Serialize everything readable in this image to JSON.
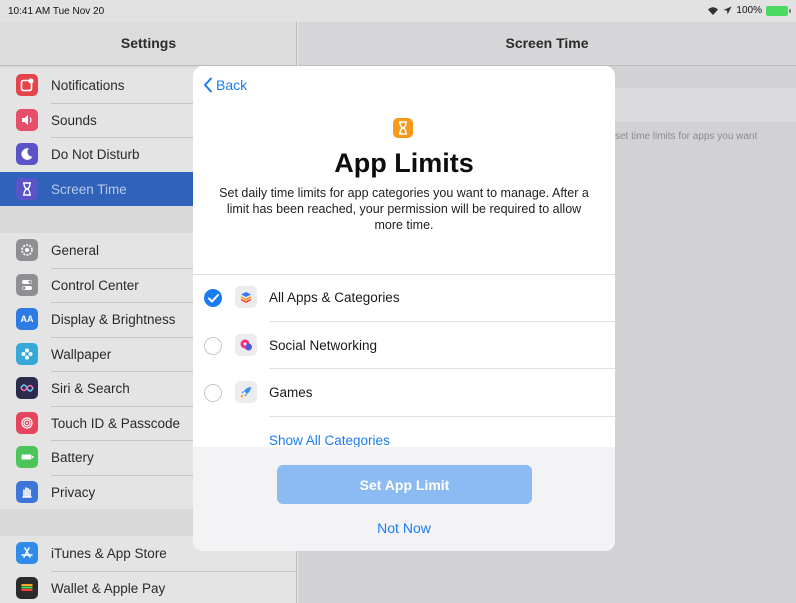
{
  "status_bar": {
    "time": "10:41 AM  Tue Nov 20",
    "battery": "100%"
  },
  "sidebar": {
    "title": "Settings",
    "groups": [
      [
        {
          "label": "Notifications",
          "icon": "notifications-icon",
          "color": "#e4454a"
        },
        {
          "label": "Sounds",
          "icon": "speaker-icon",
          "color": "#e64e6a"
        },
        {
          "label": "Do Not Disturb",
          "icon": "moon-icon",
          "color": "#5a54c8"
        },
        {
          "label": "Screen Time",
          "icon": "hourglass-icon",
          "color": "#5a54c8",
          "selected": true
        }
      ],
      [
        {
          "label": "General",
          "icon": "gear-icon",
          "color": "#8e8e93"
        },
        {
          "label": "Control Center",
          "icon": "switches-icon",
          "color": "#8e8e93"
        },
        {
          "label": "Display & Brightness",
          "icon": "text-size-icon",
          "color": "#2f7be6"
        },
        {
          "label": "Wallpaper",
          "icon": "flower-icon",
          "color": "#36a9d6"
        },
        {
          "label": "Siri & Search",
          "icon": "siri-icon",
          "color": "#2b2b4c"
        },
        {
          "label": "Touch ID & Passcode",
          "icon": "fingerprint-icon",
          "color": "#e6455e"
        },
        {
          "label": "Battery",
          "icon": "battery-icon",
          "color": "#4bc55a"
        },
        {
          "label": "Privacy",
          "icon": "hand-icon",
          "color": "#3d76d8"
        }
      ],
      [
        {
          "label": "iTunes & App Store",
          "icon": "app-store-icon",
          "color": "#2f8ce8"
        },
        {
          "label": "Wallet & Apple Pay",
          "icon": "wallet-icon",
          "color": "#2b2b2b"
        }
      ]
    ]
  },
  "main": {
    "title": "Screen Time",
    "hint": "set time limits for apps you want"
  },
  "modal": {
    "back_label": "Back",
    "title": "App Limits",
    "description": "Set daily time limits for app categories you want to manage. After a limit has been reached, your permission will be required to allow more time.",
    "options": [
      {
        "label": "All Apps & Categories",
        "checked": true,
        "icon": "layers-icon"
      },
      {
        "label": "Social Networking",
        "checked": false,
        "icon": "chat-bubbles-icon"
      },
      {
        "label": "Games",
        "checked": false,
        "icon": "rocket-icon"
      }
    ],
    "show_all_label": "Show All Categories",
    "primary_button": "Set App Limit",
    "secondary_button": "Not Now"
  },
  "colors": {
    "accent": "#1a7cf5",
    "hero_icon": "#f79a1b",
    "selection": "#2f62b8"
  }
}
